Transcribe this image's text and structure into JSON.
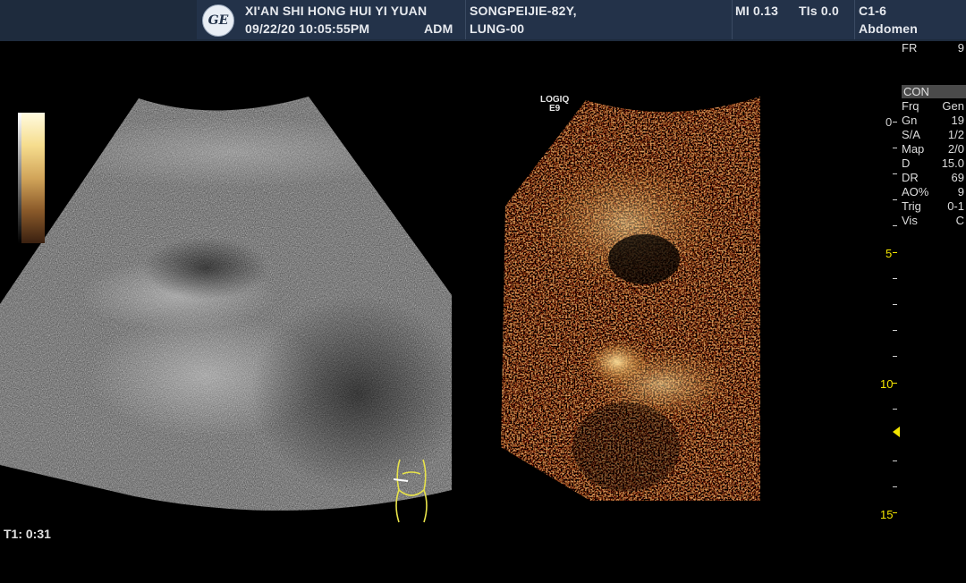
{
  "header": {
    "hospital": "XI'AN SHI HONG HUI YI YUAN",
    "datetime": "09/22/20 10:05:55PM",
    "operator": "ADM",
    "patient": "SONGPEIJIE-82Y,",
    "patient_id": "LUNG-00",
    "mi": "MI 0.13",
    "tis": "TIs 0.0",
    "probe": "C1-6",
    "preset": "Abdomen"
  },
  "side_params": {
    "fr_label": "FR",
    "fr_value": "9",
    "mode_label": "CON",
    "rows": [
      {
        "k": "Frq",
        "v": "Gen"
      },
      {
        "k": "Gn",
        "v": "19"
      },
      {
        "k": "S/A",
        "v": "1/2"
      },
      {
        "k": "Map",
        "v": "2/0"
      },
      {
        "k": "D",
        "v": "15.0"
      },
      {
        "k": "DR",
        "v": "69"
      },
      {
        "k": "AO%",
        "v": "9"
      },
      {
        "k": "Trig",
        "v": "0-1"
      },
      {
        "k": "Vis",
        "v": "C"
      }
    ]
  },
  "depth_scale": {
    "labels": [
      "0",
      "5",
      "10",
      "15"
    ],
    "label_colors": [
      "#d0d0d0",
      "#f2e400",
      "#f2e400",
      "#f2e400"
    ]
  },
  "image_labels": {
    "logiq_line1": "LOGIQ",
    "logiq_line2": "E9",
    "timer": "T1: 0:31"
  },
  "colors": {
    "header_bg": "#233249",
    "marker": "#f2e400",
    "contrast_tint": "#c07a2a"
  },
  "icons": {
    "logo": "ge-logo",
    "depth_marker": "focus-marker-triangle",
    "body_marker": "body-marker-icon"
  }
}
